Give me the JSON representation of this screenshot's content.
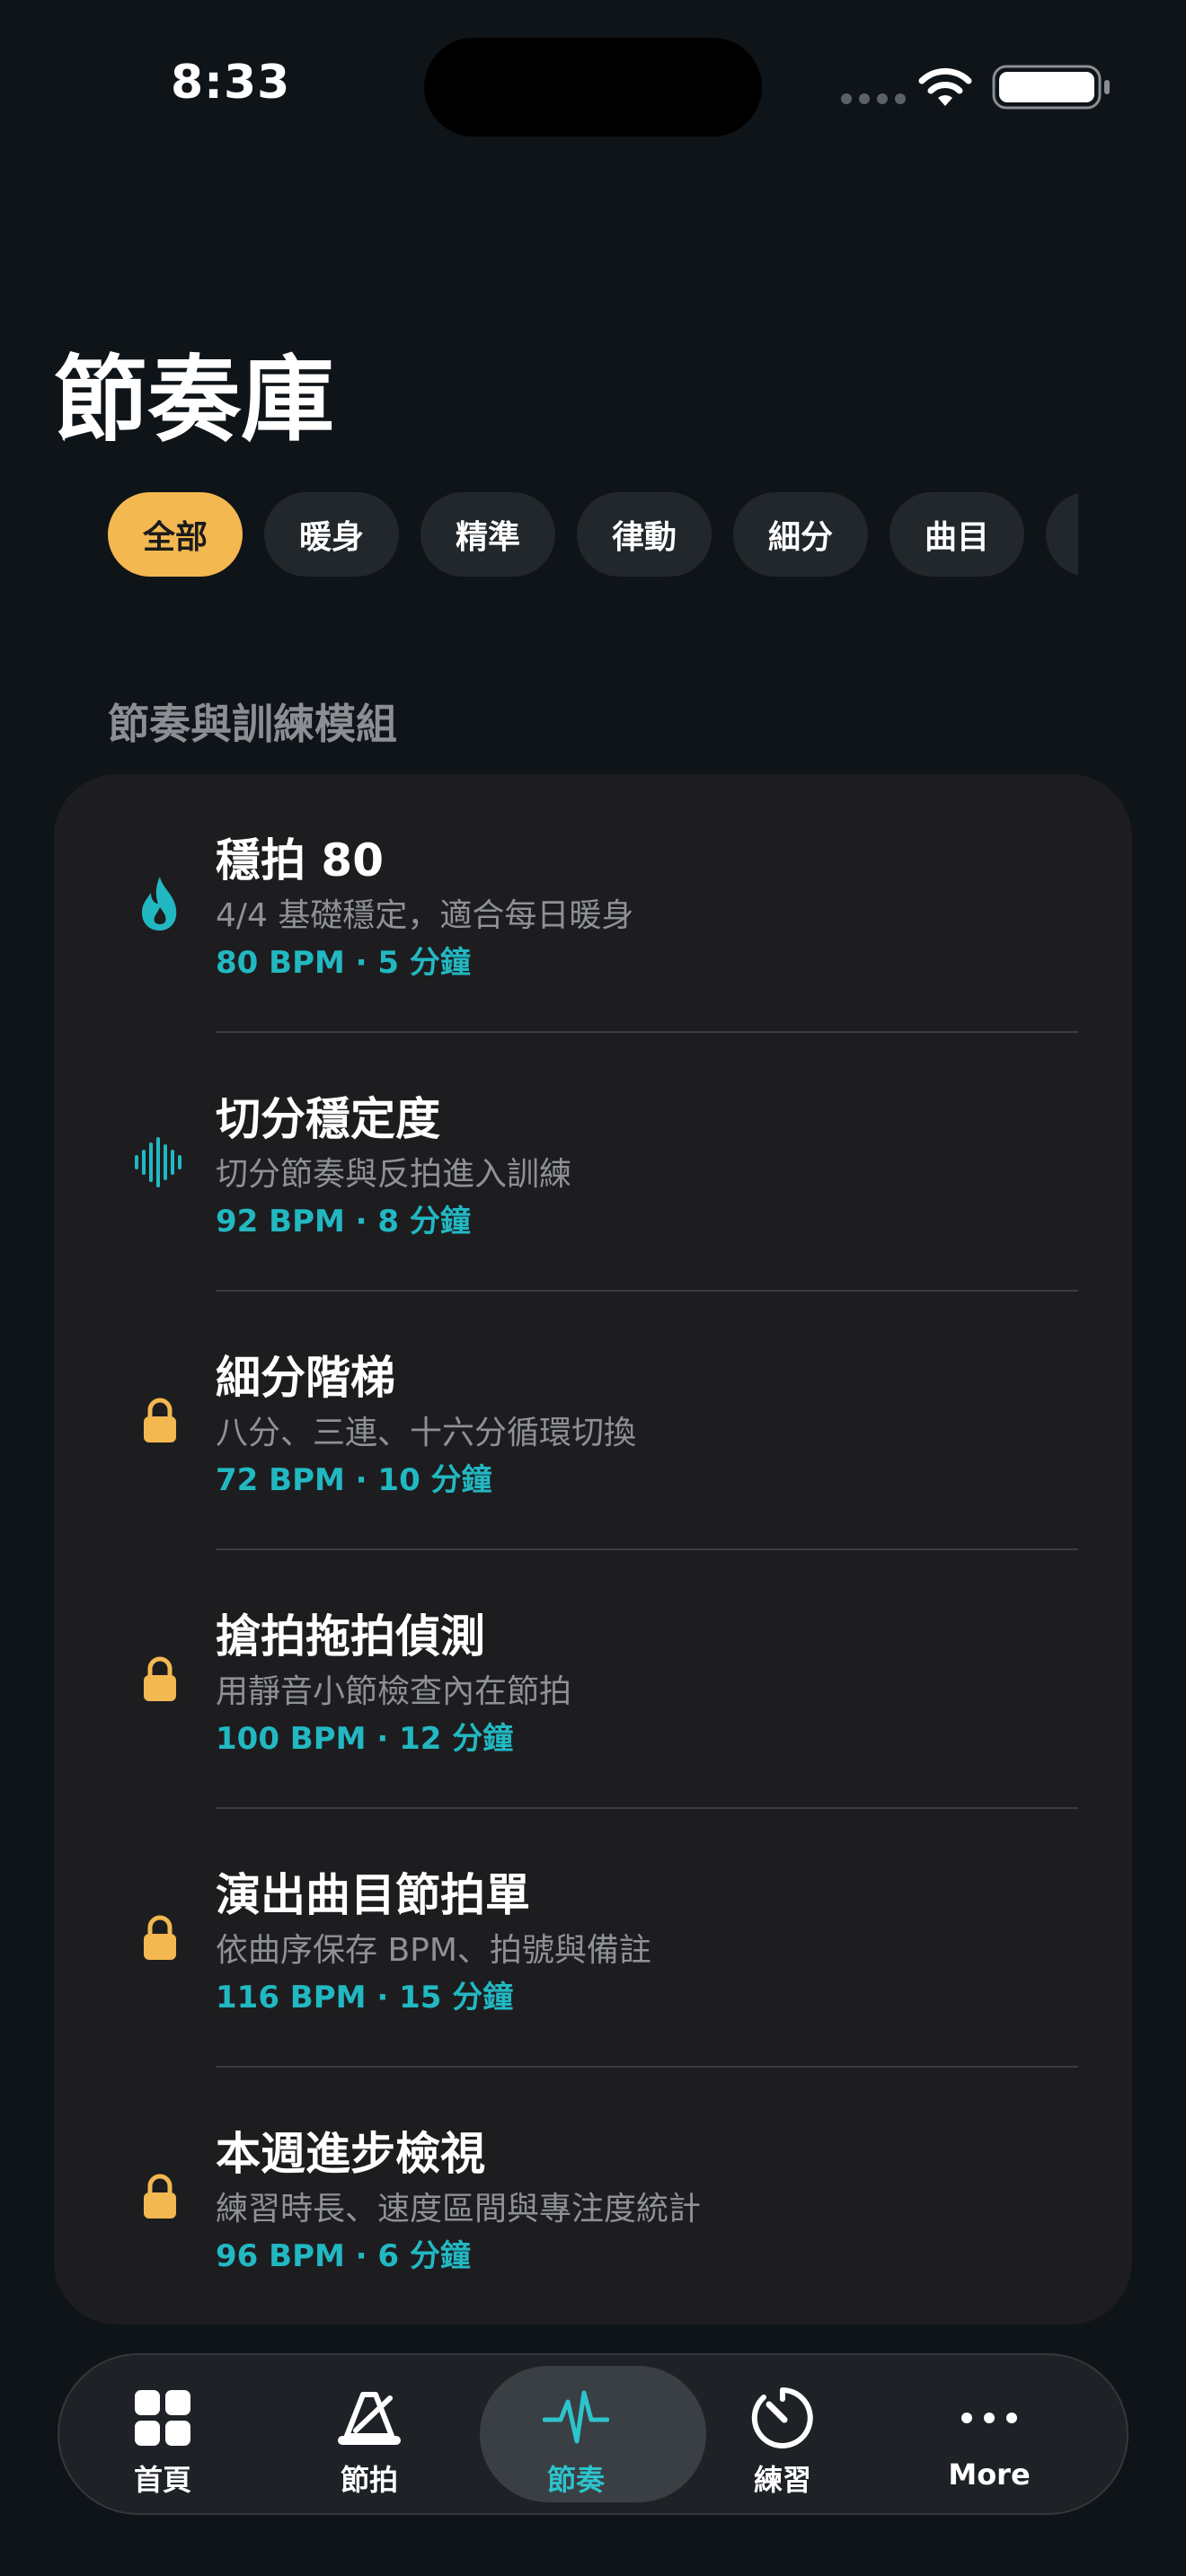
{
  "status": {
    "time": "8:33"
  },
  "page": {
    "title": "節奏庫"
  },
  "filters": [
    {
      "label": "全部",
      "active": true
    },
    {
      "label": "暖身",
      "active": false
    },
    {
      "label": "精準",
      "active": false
    },
    {
      "label": "律動",
      "active": false
    },
    {
      "label": "細分",
      "active": false
    },
    {
      "label": "曲目",
      "active": false
    },
    {
      "label": "",
      "active": false
    }
  ],
  "section": {
    "title": "節奏與訓練模組"
  },
  "items": [
    {
      "icon": "flame-icon",
      "title": "穩拍 80",
      "desc": "4/4 基礎穩定，適合每日暖身",
      "meta": "80 BPM · 5 分鐘"
    },
    {
      "icon": "waveform-icon",
      "title": "切分穩定度",
      "desc": "切分節奏與反拍進入訓練",
      "meta": "92 BPM · 8 分鐘"
    },
    {
      "icon": "lock-icon",
      "title": "細分階梯",
      "desc": "八分、三連、十六分循環切換",
      "meta": "72 BPM · 10 分鐘"
    },
    {
      "icon": "lock-icon",
      "title": "搶拍拖拍偵測",
      "desc": "用靜音小節檢查內在節拍",
      "meta": "100 BPM · 12 分鐘"
    },
    {
      "icon": "lock-icon",
      "title": "演出曲目節拍單",
      "desc": "依曲序保存 BPM、拍號與備註",
      "meta": "116 BPM · 15 分鐘"
    },
    {
      "icon": "lock-icon",
      "title": "本週進步檢視",
      "desc": "練習時長、速度區間與專注度統計",
      "meta": "96 BPM · 6 分鐘"
    }
  ],
  "tabs": [
    {
      "label": "首頁",
      "icon": "grid-icon"
    },
    {
      "label": "節拍",
      "icon": "metronome-icon"
    },
    {
      "label": "節奏",
      "icon": "pulse-icon",
      "selected": true
    },
    {
      "label": "練習",
      "icon": "timer-icon"
    },
    {
      "label": "More",
      "icon": "more-icon"
    }
  ],
  "colors": {
    "accent": "#f3b850",
    "teal": "#22b8c2",
    "background": "#0f1418",
    "card": "#1d1d20"
  }
}
